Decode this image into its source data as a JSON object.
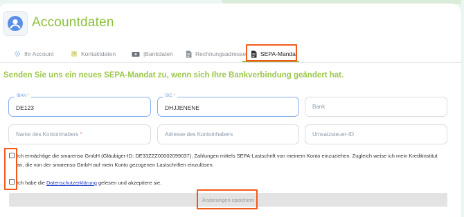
{
  "header": {
    "title": "Accountdaten",
    "icon": "user-circle-icon"
  },
  "tabs": [
    {
      "label": "Ihr Account",
      "icon": "gear-icon",
      "active": false
    },
    {
      "label": "Kontaktdaten",
      "icon": "contact-card-icon",
      "active": false
    },
    {
      "label": "|Bankdaten",
      "icon": "money-icon",
      "active": false
    },
    {
      "label": "Rechnungsadresse",
      "icon": "document-icon",
      "active": false
    },
    {
      "label": "SEPA-Mandat",
      "icon": "document-icon",
      "active": true
    }
  ],
  "headline": "Senden Sie uns ein neues SEPA-Mandat zu, wenn sich Ihre Bankverbindung geändert hat.",
  "form": {
    "iban": {
      "label": "IBAN",
      "required": "*",
      "value": "DE123"
    },
    "bic": {
      "label": "BIC",
      "required": "*",
      "value": "DHJJENENE"
    },
    "bank": {
      "placeholder": "Bank"
    },
    "account_holder_name": {
      "placeholder": "Name des Kontoinhabers",
      "required": "*"
    },
    "account_holder_address": {
      "placeholder": "Adresse des Kontoinhabers"
    },
    "vat_id": {
      "placeholder": "Umsatzsteuer-ID"
    }
  },
  "consents": {
    "mandate_text": "Ich ermächtige die smarenso GmbH (Gläubiger-ID: DE33ZZZ00002099037), Zahlungen mittels SEPA-Lastschrift von meinem Konto einzuziehen. Zugleich weise ich mein Kreditinstitut an, die von der smarenso GmbH auf mein Konto gezogenen Lastschriften einzulösen.",
    "privacy_prefix": "Ich habe die ",
    "privacy_link": "Datenschutzerklärung",
    "privacy_suffix": " gelesen und akzeptiere sie."
  },
  "save_button": "Änderungen speichern",
  "colors": {
    "brand_green": "#8cc03a",
    "highlight_orange": "#f25a1c",
    "field_focus_blue": "#86aef0",
    "link_blue": "#2340c8"
  }
}
